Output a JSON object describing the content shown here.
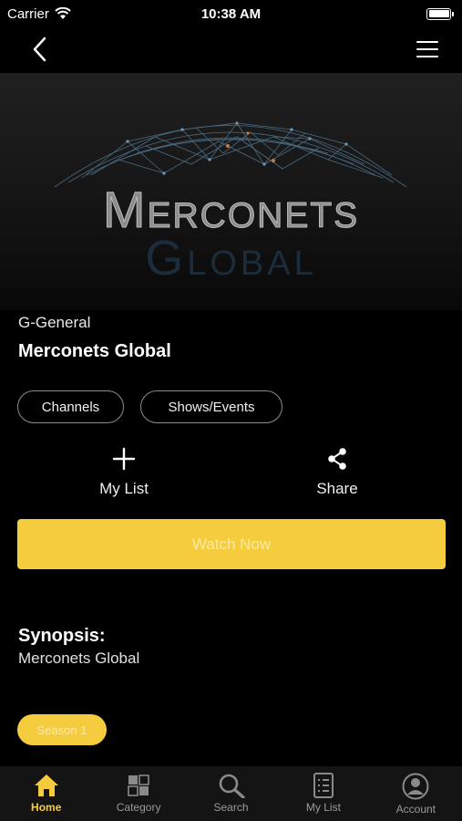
{
  "status_bar": {
    "carrier": "Carrier",
    "time": "10:38 AM"
  },
  "hero": {
    "logo_title": "Merconets",
    "logo_subtitle": "Global"
  },
  "content": {
    "rating": "G-General",
    "title": "Merconets Global",
    "pills": [
      "Channels",
      "Shows/Events"
    ],
    "actions": {
      "my_list": "My List",
      "share": "Share"
    },
    "watch_now": "Watch Now",
    "synopsis_label": "Synopsis:",
    "synopsis_text": "Merconets Global",
    "season": "Season 1"
  },
  "tab_bar": {
    "items": [
      {
        "label": "Home",
        "icon": "home-icon",
        "active": true
      },
      {
        "label": "Category",
        "icon": "category-icon",
        "active": false
      },
      {
        "label": "Search",
        "icon": "search-icon",
        "active": false
      },
      {
        "label": "My List",
        "icon": "list-icon",
        "active": false
      },
      {
        "label": "Account",
        "icon": "account-icon",
        "active": false
      }
    ]
  },
  "colors": {
    "accent": "#f5cc3e",
    "background": "#000000",
    "tab_bar": "#141414",
    "inactive": "#9a9a9a"
  }
}
